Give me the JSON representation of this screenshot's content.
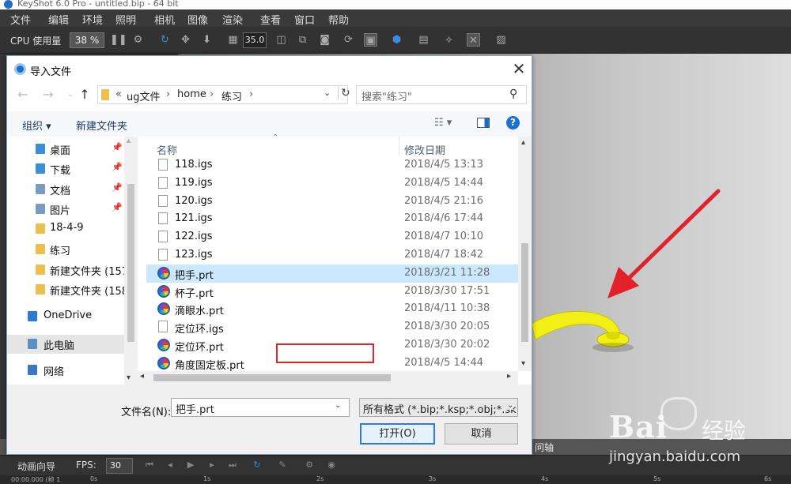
{
  "app": {
    "title": "KeyShot 6.0 Pro - untitled.bip - 64 bit",
    "menu": [
      "文件",
      "编辑",
      "环境",
      "照明",
      "相机",
      "图像",
      "渲染",
      "查看",
      "窗口",
      "帮助"
    ],
    "toolbar": {
      "cpu_label": "CPU 使用量",
      "cpu_value": "38 %",
      "num_value": "35.0"
    },
    "bottom_strip_label": "问轴",
    "anim": {
      "label": "动画向导",
      "fps_label": "FPS:",
      "fps_value": "30"
    },
    "timeline_ticks": [
      "0s",
      "1s",
      "2s",
      "3s",
      "4s",
      "5s",
      "6s"
    ],
    "timeline_left": "00:00.000 (帧 1"
  },
  "dialog": {
    "title": "导入文件",
    "address": {
      "prefix": "«",
      "segments": [
        "ug文件",
        "home",
        "练习"
      ]
    },
    "search_placeholder": "搜索\"练习\"",
    "cmd": {
      "organize": "组织 ▾",
      "new_folder": "新建文件夹"
    },
    "nav": [
      {
        "label": "桌面",
        "pinned": true,
        "icon_color": "#3b8fd6"
      },
      {
        "label": "下载",
        "pinned": true,
        "icon_color": "#3b8fd6"
      },
      {
        "label": "文档",
        "pinned": true,
        "icon_color": "#7a9cc3"
      },
      {
        "label": "图片",
        "pinned": true,
        "icon_color": "#7a9cc3"
      },
      {
        "label": "18-4-9",
        "pinned": false,
        "icon_color": "#ecc04d"
      },
      {
        "label": "练习",
        "pinned": false,
        "icon_color": "#ecc04d"
      },
      {
        "label": "新建文件夹 (157",
        "pinned": false,
        "icon_color": "#ecc04d"
      },
      {
        "label": "新建文件夹 (158",
        "pinned": false,
        "icon_color": "#ecc04d"
      },
      {
        "label": "OneDrive",
        "pinned": false,
        "icon_color": "#2b7cd3"
      },
      {
        "label": "此电脑",
        "pinned": false,
        "icon_color": "#5a8fc8"
      },
      {
        "label": "网络",
        "pinned": false,
        "icon_color": "#3a78c2"
      }
    ],
    "columns": {
      "name": "名称",
      "date": "修改日期"
    },
    "files": [
      {
        "name": "118.igs",
        "date": "2018/4/5 13:13",
        "type": "igs"
      },
      {
        "name": "119.igs",
        "date": "2018/4/5 14:44",
        "type": "igs"
      },
      {
        "name": "120.igs",
        "date": "2018/4/5 21:16",
        "type": "igs"
      },
      {
        "name": "121.igs",
        "date": "2018/4/6 17:44",
        "type": "igs"
      },
      {
        "name": "122.igs",
        "date": "2018/4/7 10:10",
        "type": "igs"
      },
      {
        "name": "123.igs",
        "date": "2018/4/7 18:42",
        "type": "igs"
      },
      {
        "name": "把手.prt",
        "date": "2018/3/21 11:28",
        "type": "prt",
        "selected": true
      },
      {
        "name": "杯子.prt",
        "date": "2018/3/30 17:51",
        "type": "prt"
      },
      {
        "name": "滴眼水.prt",
        "date": "2018/4/11 10:38",
        "type": "prt"
      },
      {
        "name": "定位环.igs",
        "date": "2018/3/30 20:05",
        "type": "igs"
      },
      {
        "name": "定位环.prt",
        "date": "2018/3/30 20:02",
        "type": "prt"
      },
      {
        "name": "角度固定板.prt",
        "date": "2018/4/5 14:44",
        "type": "prt"
      }
    ],
    "filename_label": "文件名(N):",
    "filename_value": "把手.prt",
    "filetype_value": "所有格式 (*.bip;*.ksp;*.obj;*.sk",
    "open_label": "打开(O)",
    "cancel_label": "取消"
  },
  "watermark": {
    "brand_left": "Bai",
    "brand_right": "经验",
    "url": "jingyan.baidu.com"
  }
}
